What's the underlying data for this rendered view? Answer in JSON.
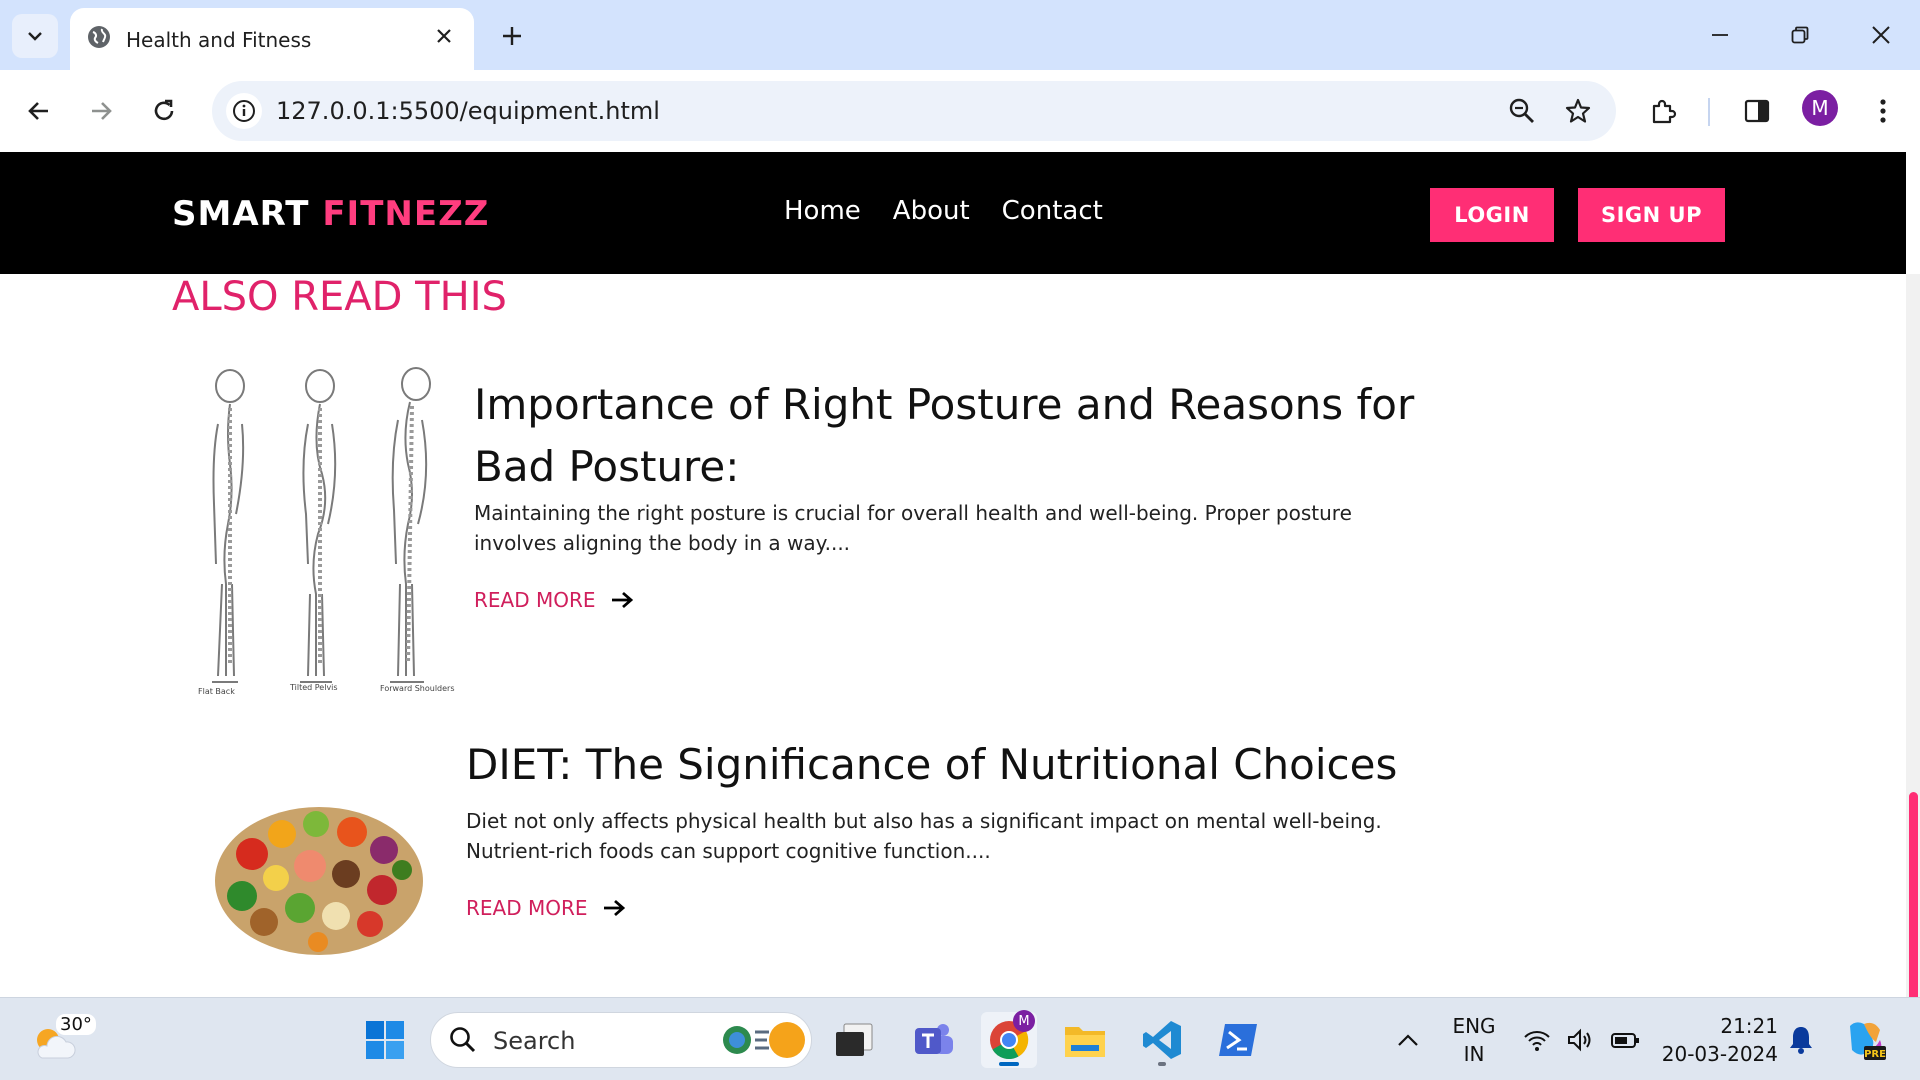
{
  "browser": {
    "tab_title": "Health and Fitness",
    "url": "127.0.0.1:5500/equipment.html",
    "profile_initial": "M"
  },
  "site": {
    "logo_primary": "SMART",
    "logo_accent": "FITNEZZ",
    "nav": [
      "Home",
      "About",
      "Contact"
    ],
    "login_label": "LOGIN",
    "signup_label": "SIGN UP",
    "brand_color": "#ff2e75"
  },
  "section": {
    "title": "ALSO READ THIS"
  },
  "articles": [
    {
      "title": "Importance of Right Posture and Reasons for Bad Posture:",
      "description": "Maintaining the right posture is crucial for overall health and well-being. Proper posture involves aligning the body in a way....",
      "read_more": "READ MORE",
      "image_labels": [
        "Flat Back",
        "Tilted Pelvis",
        "Forward Shoulders"
      ]
    },
    {
      "title": "DIET: The Significance of Nutritional Choices",
      "description": "Diet not only affects physical health but also has a significant impact on mental well-being. Nutrient-rich foods can support cognitive function....",
      "read_more": "READ MORE"
    }
  ],
  "taskbar": {
    "temperature": "30°",
    "search_placeholder": "Search",
    "language_line1": "ENG",
    "language_line2": "IN",
    "time": "21:21",
    "date": "20-03-2024",
    "chrome_badge": "M"
  }
}
